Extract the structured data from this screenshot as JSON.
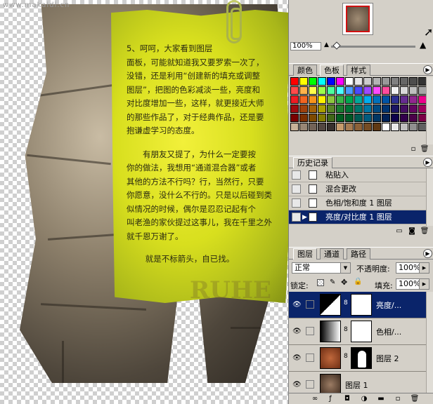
{
  "watermark": "www.makaidi.cn",
  "note": {
    "paragraph1": "5、呵呵，大家看到图层\n面板，可能就知道我又要罗索一次了，\n没错，还是利用“创建新的填充或调整\n图层”，把图的色彩减淡一些，亮度和\n对比度增加一些，这样，就更接近大师\n的那些作品了，对于经典作品，还是要\n抱谦虚学习的态度。",
    "paragraph2": "有朋友又提了，为什么一定要按\n你的做法，我想用“通道混合器”或者\n其他的方法不行吗？行，当然行，只要\n你愿意，没什么不行的。只是以后碰到类\n似情况的时候，偶尔是忍忍记起有个\n叫老渔的家伙提过这事儿，我在千里之外\n就千恩万谢了。",
    "footer": "就是不标箭头，自已找。"
  },
  "stone_lettering": "RUHE",
  "navigator": {
    "zoom": "100%"
  },
  "swatches": {
    "tabs": [
      "颜色",
      "色板",
      "样式"
    ],
    "active_tab": 1,
    "colors": [
      "#ff0000",
      "#ffff00",
      "#00ff00",
      "#00ffff",
      "#0000ff",
      "#ff00ff",
      "#ffffff",
      "#e6e6e6",
      "#cccccc",
      "#b3b3b3",
      "#999999",
      "#808080",
      "#666666",
      "#4d4d4d",
      "#333333",
      "#000000",
      "#ff4b4b",
      "#ffb34b",
      "#ffff4b",
      "#9dff4b",
      "#4bff9d",
      "#4bffff",
      "#4b9dff",
      "#4b4bff",
      "#9d4bff",
      "#ff4bff",
      "#ff4b9d",
      "#f2f2f2",
      "#d9d9d9",
      "#bfbfbf",
      "#a6a6a6",
      "#8c8c8c",
      "#ee1c24",
      "#f26522",
      "#f7941d",
      "#fff200",
      "#8dc63f",
      "#39b54a",
      "#00a651",
      "#00a99d",
      "#00aeef",
      "#0072bc",
      "#0054a6",
      "#2e3192",
      "#662d91",
      "#92278f",
      "#ec008c",
      "#ed145b",
      "#9e0b0f",
      "#a0410d",
      "#a36209",
      "#aba000",
      "#598527",
      "#197b30",
      "#007236",
      "#00746b",
      "#0076a3",
      "#004a80",
      "#003471",
      "#1b1464",
      "#440e62",
      "#630460",
      "#9e005d",
      "#9e0039",
      "#790000",
      "#7b2e00",
      "#7d4900",
      "#827b00",
      "#406618",
      "#005e20",
      "#005826",
      "#005952",
      "#005b7f",
      "#003663",
      "#002157",
      "#0d004c",
      "#32004b",
      "#4b0049",
      "#7b0046",
      "#7a0026",
      "#c7b299",
      "#998675",
      "#736357",
      "#534741",
      "#37302d",
      "#c69c6d",
      "#a67c52",
      "#8c6239",
      "#754c24",
      "#603913",
      "#ffffff",
      "#e8e8e8",
      "#c0c0c0",
      "#909090",
      "#606060",
      "#303030"
    ]
  },
  "history": {
    "tab": "历史记录",
    "items": [
      {
        "label": "粘贴入",
        "selected": false
      },
      {
        "label": "混合更改",
        "selected": false
      },
      {
        "label": "色相/饱和度 1 图层",
        "selected": false
      },
      {
        "label": "亮度/对比度 1 图层",
        "selected": true
      }
    ]
  },
  "layers": {
    "tabs": [
      "图层",
      "通道",
      "路径"
    ],
    "blend_mode": "正常",
    "opacity_label": "不透明度:",
    "opacity_value": "100%",
    "lock_label": "锁定:",
    "fill_label": "填充:",
    "fill_value": "100%",
    "items": [
      {
        "name": "亮度/...",
        "type": "adjustment",
        "selected": true
      },
      {
        "name": "色相/...",
        "type": "adjustment",
        "selected": false
      },
      {
        "name": "图层 2",
        "type": "pixel",
        "selected": false
      },
      {
        "name": "图层 1",
        "type": "pixel",
        "selected": false
      }
    ]
  },
  "icons": {
    "eye": "eye-icon",
    "history_brush": "history-brush-icon",
    "link": "chain-link-icon",
    "new_snapshot": "camera-icon",
    "trash": "trash-icon",
    "new_layer": "new-layer-icon",
    "panel_menu": "triangle-menu-icon"
  }
}
